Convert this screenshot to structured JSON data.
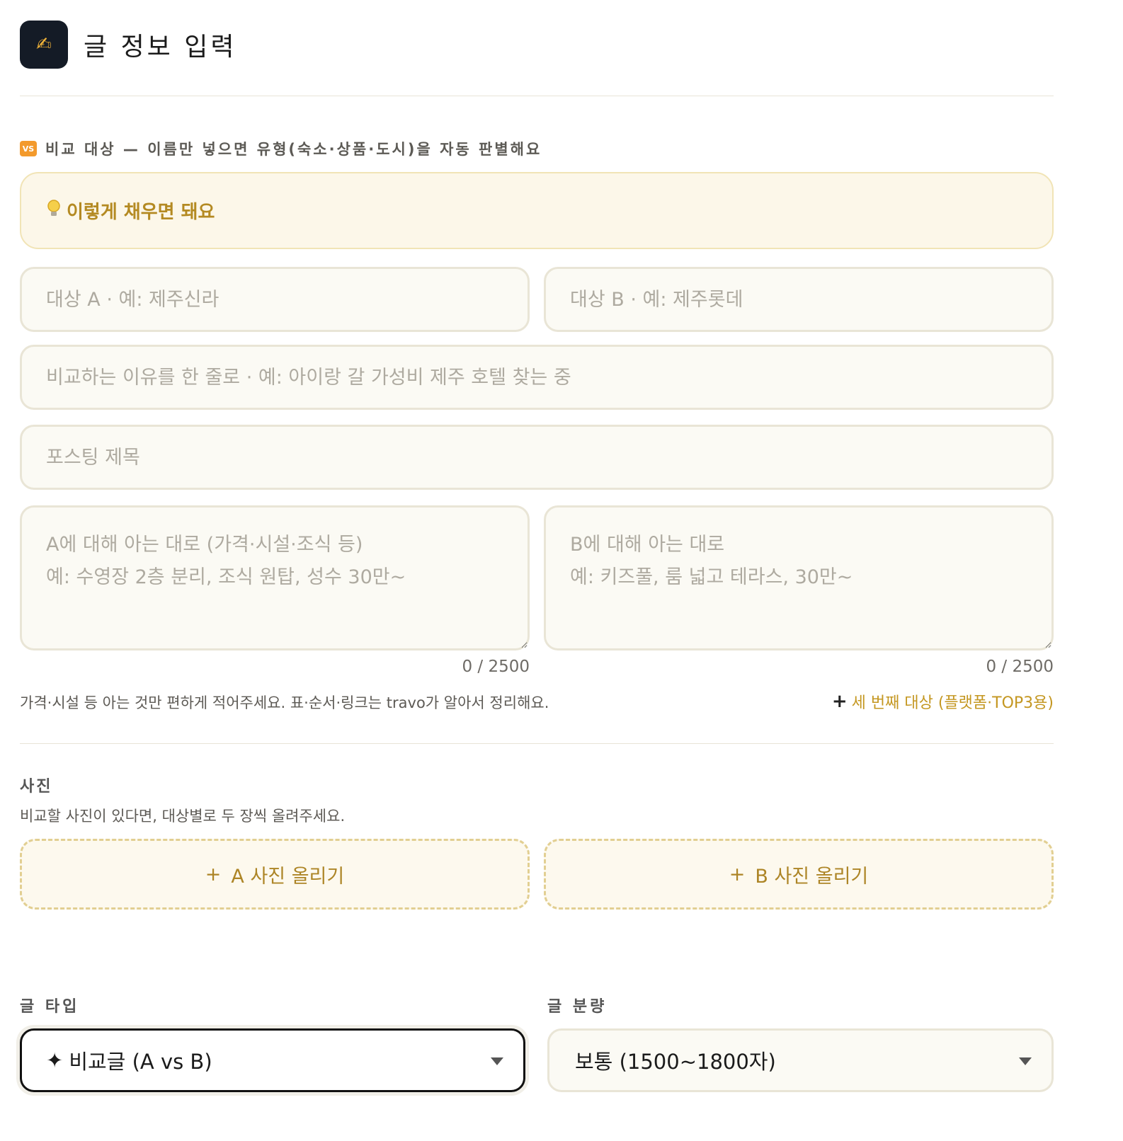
{
  "header": {
    "icon_glyph": "✍",
    "title": "글 정보 입력"
  },
  "compare": {
    "badge": "VS",
    "label": "비교 대상 — 이름만 넣으면 유형(숙소·상품·도시)을 자동 판별해요",
    "hint": "이렇게 채우면 돼요",
    "target_a_placeholder": "대상 A · 예: 제주신라",
    "target_b_placeholder": "대상 B · 예: 제주롯데",
    "reason_placeholder": "비교하는 이유를 한 줄로 · 예: 아이랑 갈 가성비 제주 호텔 찾는 중",
    "title_placeholder": "포스팅 제목",
    "notes_a_placeholder": "A에 대해 아는 대로 (가격·시설·조식 등)\n예: 수영장 2층 분리, 조식 원탑, 성수 30만~",
    "notes_b_placeholder": "B에 대해 아는 대로\n예: 키즈풀, 룸 넓고 테라스, 30만~",
    "counter_a": "0 / 2500",
    "counter_b": "0 / 2500",
    "helper": "가격·시설 등 아는 것만 편하게 적어주세요. 표·순서·링크는 travo가 알아서 정리해요.",
    "add_third_plus": "+",
    "add_third": "세 번째 대상 (플랫폼·TOP3용)"
  },
  "photos": {
    "title": "사진",
    "desc": "비교할 사진이 있다면, 대상별로 두 장씩 올려주세요.",
    "plus": "+",
    "upload_a": "A 사진 올리기",
    "upload_b": "B 사진 올리기"
  },
  "options": {
    "type_label": "글 타입",
    "type_icon": "✦",
    "type_value": "비교글 (A vs B)",
    "length_label": "글 분량",
    "length_value": "보통 (1500~1800자)"
  },
  "colors": {
    "accent": "#c49721",
    "hint_bg": "#fcf7e9",
    "field_bg": "#fbfaf4",
    "app_icon_bg": "#141b26"
  }
}
